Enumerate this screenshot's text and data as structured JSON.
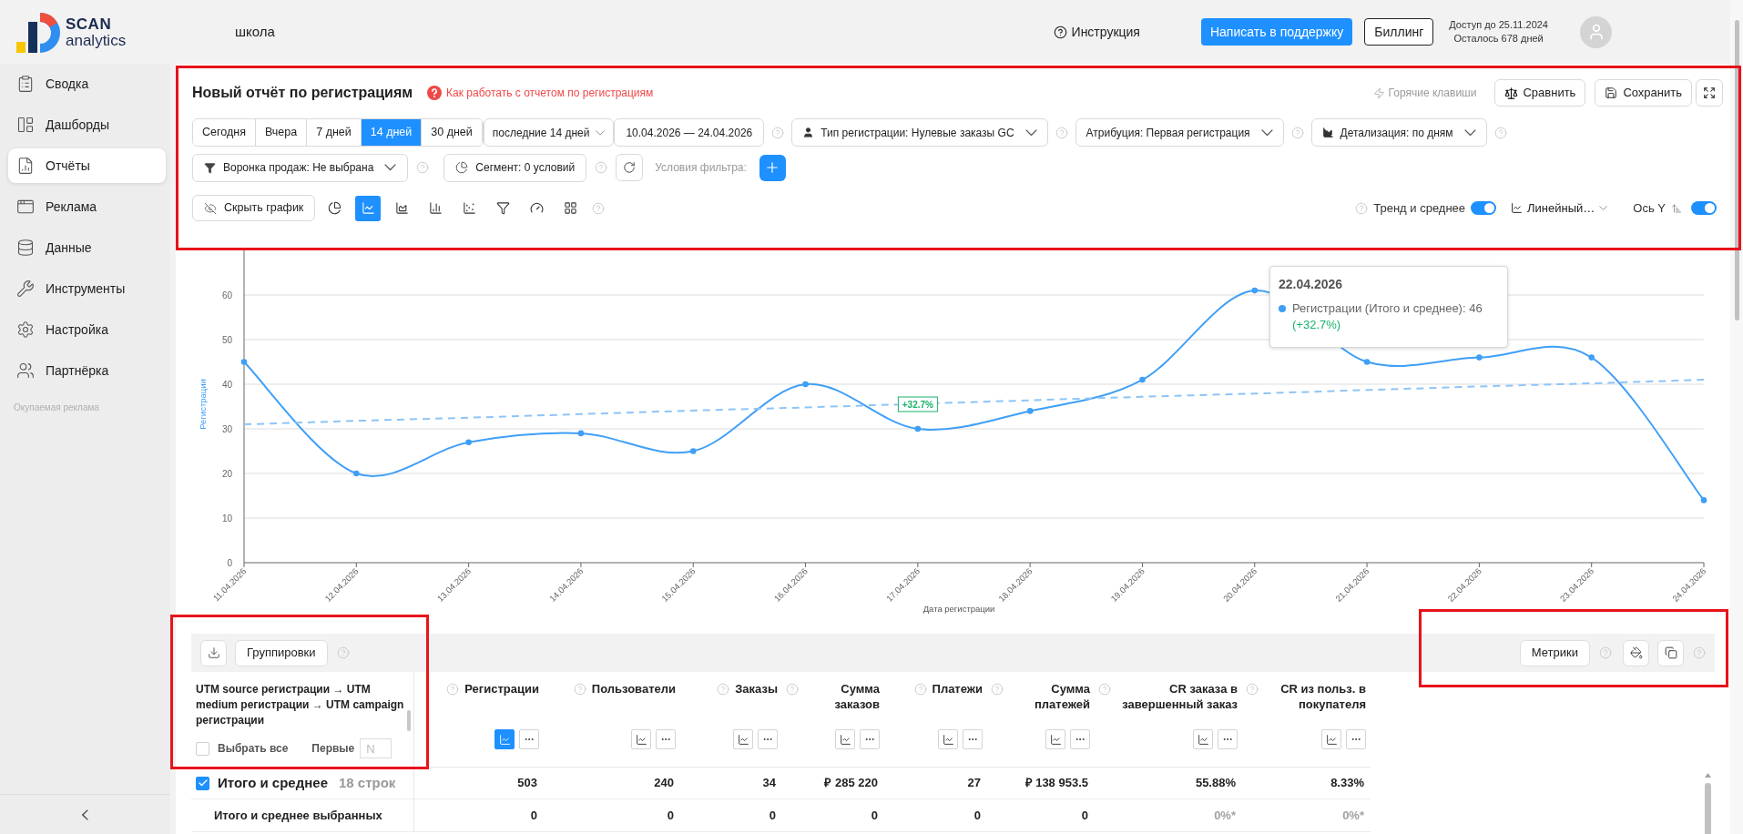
{
  "header": {
    "logo_title": "SCAN",
    "logo_subtitle": "analytics",
    "project": "школа",
    "help_link": "Инструкция",
    "support_button": "Написать в поддержку",
    "billing_button": "Биллинг",
    "access_until": "Доступ до 25.11.2024",
    "days_left": "Осталось 678 дней"
  },
  "sidebar": {
    "items": [
      {
        "label": "Сводка",
        "selected": false
      },
      {
        "label": "Дашборды",
        "selected": false
      },
      {
        "label": "Отчёты",
        "selected": true
      },
      {
        "label": "Реклама",
        "selected": false
      },
      {
        "label": "Данные",
        "selected": false
      },
      {
        "label": "Инструменты",
        "selected": false
      },
      {
        "label": "Настройка",
        "selected": false
      },
      {
        "label": "Партнёрка",
        "selected": false
      }
    ],
    "section_label": "Окупаемая реклама"
  },
  "report": {
    "title": "Новый отчёт по регистрациям",
    "help_link": "Как работать с отчетом по регистрациям",
    "hotkeys": "Горячие клавиши",
    "compare_button": "Сравнить",
    "save_button": "Сохранить",
    "periods": [
      {
        "label": "Сегодня",
        "selected": false
      },
      {
        "label": "Вчера",
        "selected": false
      },
      {
        "label": "7 дней",
        "selected": false
      },
      {
        "label": "14 дней",
        "selected": true
      },
      {
        "label": "30 дней",
        "selected": false
      }
    ],
    "period_select": "последние 14 дней",
    "date_range": "10.04.2026 — 24.04.2026",
    "filters": [
      {
        "label": "Тип регистрации: Нулевые заказы GC"
      },
      {
        "label": "Атрибуция: Первая регистрация"
      },
      {
        "label": "Детализация: по дням"
      }
    ],
    "funnel_select": "Воронка продаж: Не выбрана",
    "segment_button": "Сегмент: 0 условий",
    "filter_conditions_label": "Условия фильтра:",
    "hide_chart_button": "Скрыть график",
    "chart_types": [
      {
        "selected": false
      },
      {
        "selected": true
      },
      {
        "selected": false
      },
      {
        "selected": false
      },
      {
        "selected": false
      },
      {
        "selected": false
      },
      {
        "selected": false
      },
      {
        "selected": false
      }
    ],
    "trend_toggle": {
      "label": "Тренд и среднее",
      "on": true
    },
    "scale_select": "Линейный…",
    "axis_toggle": {
      "label": "Ось Y",
      "on": true
    }
  },
  "chart": {
    "chart_data": {
      "type": "line",
      "xlabel": "Дата регистрации",
      "ylabel": "Регистрации",
      "categories": [
        "11.04.2026",
        "12.04.2026",
        "13.04.2026",
        "14.04.2026",
        "15.04.2026",
        "16.04.2026",
        "17.04.2026",
        "18.04.2026",
        "19.04.2026",
        "20.04.2026",
        "21.04.2026",
        "22.04.2026",
        "23.04.2026",
        "24.04.2026"
      ],
      "series": [
        {
          "name": "Регистрации (Итого и среднее)",
          "color": "#3f9ff7",
          "marker": "circle",
          "values": [
            45,
            20,
            27,
            29,
            25,
            40,
            30,
            34,
            41,
            61,
            45,
            46,
            46,
            14
          ]
        },
        {
          "color": "#8ec4f6",
          "line_style": "dashed",
          "values": [
            31,
            31.8,
            32.5,
            33.3,
            34.1,
            34.8,
            null,
            36.4,
            37.2,
            37.9,
            38.7,
            39.5,
            40.2,
            41
          ]
        }
      ],
      "ylim": [
        0,
        70
      ],
      "yticks": [
        0,
        10,
        20,
        30,
        40,
        50,
        60
      ],
      "grid": true,
      "annotations": [
        {
          "x": "17.04.2026",
          "y": 35.6,
          "text": "+32.7%"
        }
      ]
    },
    "tooltip": {
      "title": "22.04.2026",
      "value": ": 46",
      "change": "(+32.7%)"
    }
  },
  "table": {
    "groupings_button": "Группировки",
    "metrics_button": "Метрики",
    "group_column": {
      "title": "UTM source регистрации → UTM medium регистрации → UTM campaign регистрации",
      "select_all": {
        "label": "Выбрать все",
        "checked": false
      },
      "first_label": "Первые",
      "first_placeholder": "N"
    },
    "columns": [
      {
        "title": "Регистрации",
        "chart_active": true
      },
      {
        "title": "Пользователи",
        "chart_active": false
      },
      {
        "title": "Заказы",
        "chart_active": false
      },
      {
        "title": "Сумма заказов",
        "chart_active": false
      },
      {
        "title": "Платежи",
        "chart_active": false
      },
      {
        "title": "Сумма платежей",
        "chart_active": false
      },
      {
        "title": "CR заказа в завершенный заказ",
        "chart_active": false
      },
      {
        "title": "CR из польз. в покупателя",
        "chart_active": false
      }
    ],
    "rows": [
      {
        "kind": "total",
        "checked": true,
        "label": "Итого и среднее",
        "count": "18 строк",
        "cells": [
          {
            "value": "503",
            "muted": false
          },
          {
            "value": "240",
            "muted": false
          },
          {
            "value": "34",
            "muted": false
          },
          {
            "value": "₽ 285 220",
            "muted": false
          },
          {
            "value": "27",
            "muted": false
          },
          {
            "value": "₽ 138 953.5",
            "muted": false
          },
          {
            "value": "55.88%",
            "muted": false
          },
          {
            "value": "8.33%",
            "muted": false
          }
        ]
      },
      {
        "kind": "selected_total",
        "label": "Итого и среднее выбранных",
        "cells": [
          {
            "value": "0",
            "muted": false
          },
          {
            "value": "0",
            "muted": false
          },
          {
            "value": "0",
            "muted": false
          },
          {
            "value": "0",
            "muted": false
          },
          {
            "value": "0",
            "muted": false
          },
          {
            "value": "0",
            "muted": false
          },
          {
            "value": "0%*",
            "muted": true
          },
          {
            "value": "0%*",
            "muted": true
          }
        ]
      }
    ]
  }
}
